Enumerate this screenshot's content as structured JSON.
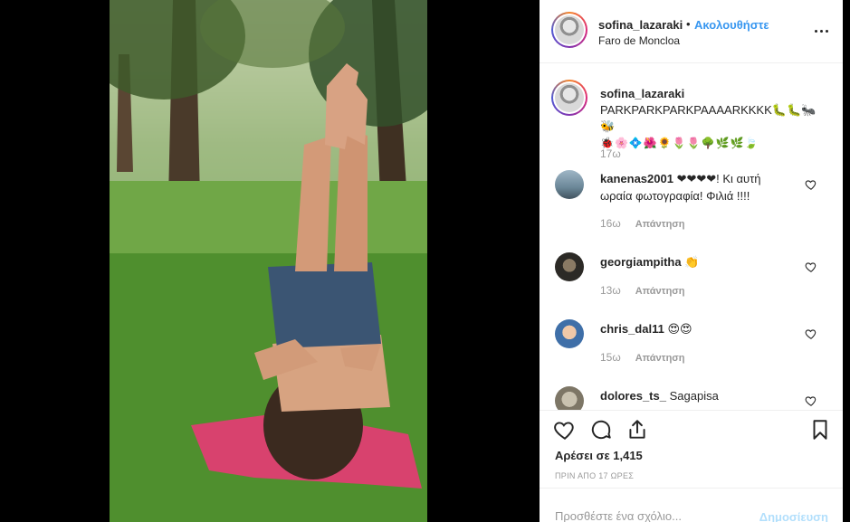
{
  "header": {
    "username": "sofina_lazaraki",
    "dot": "•",
    "follow_label": "Ακολουθήστε",
    "location": "Faro de Moncloa",
    "more_icon": "more-options-icon"
  },
  "caption": {
    "username": "sofina_lazaraki",
    "text": "PARKPARKPARKPAAAARKKKK🐛🐛🐜🐝",
    "emojis": "🐞🌸💠🌺🌻🌷🌷🌳🌿🌿🍃",
    "time": "17ω"
  },
  "comments": [
    {
      "username": "kanenas2001",
      "text": "❤❤❤❤! Κι αυτή ωραία φωτογραφία! Φιλιά !!!!",
      "time": "16ω",
      "reply": "Απάντηση"
    },
    {
      "username": "georgiampitha",
      "text": "👏",
      "time": "13ω",
      "reply": "Απάντηση"
    },
    {
      "username": "chris_dal11",
      "text": "😍😍",
      "time": "15ω",
      "reply": "Απάντηση"
    },
    {
      "username": "dolores_ts_",
      "text": "Sagapisa",
      "time": "",
      "reply": ""
    }
  ],
  "actions": {
    "icons": [
      "heart-icon",
      "comment-icon",
      "share-icon",
      "bookmark-icon"
    ],
    "likes": "Αρέσει σε 1,415",
    "date": "ΠΡΙΝ ΑΠΟ 17 ΩΡΕΣ"
  },
  "add_comment": {
    "placeholder": "Προσθέστε ένα σχόλιο...",
    "post_label": "Δημοσίευση"
  },
  "colors": {
    "link_blue": "#3897f0",
    "post_disabled": "#b2dffc",
    "muted": "#999999",
    "text": "#262626"
  }
}
